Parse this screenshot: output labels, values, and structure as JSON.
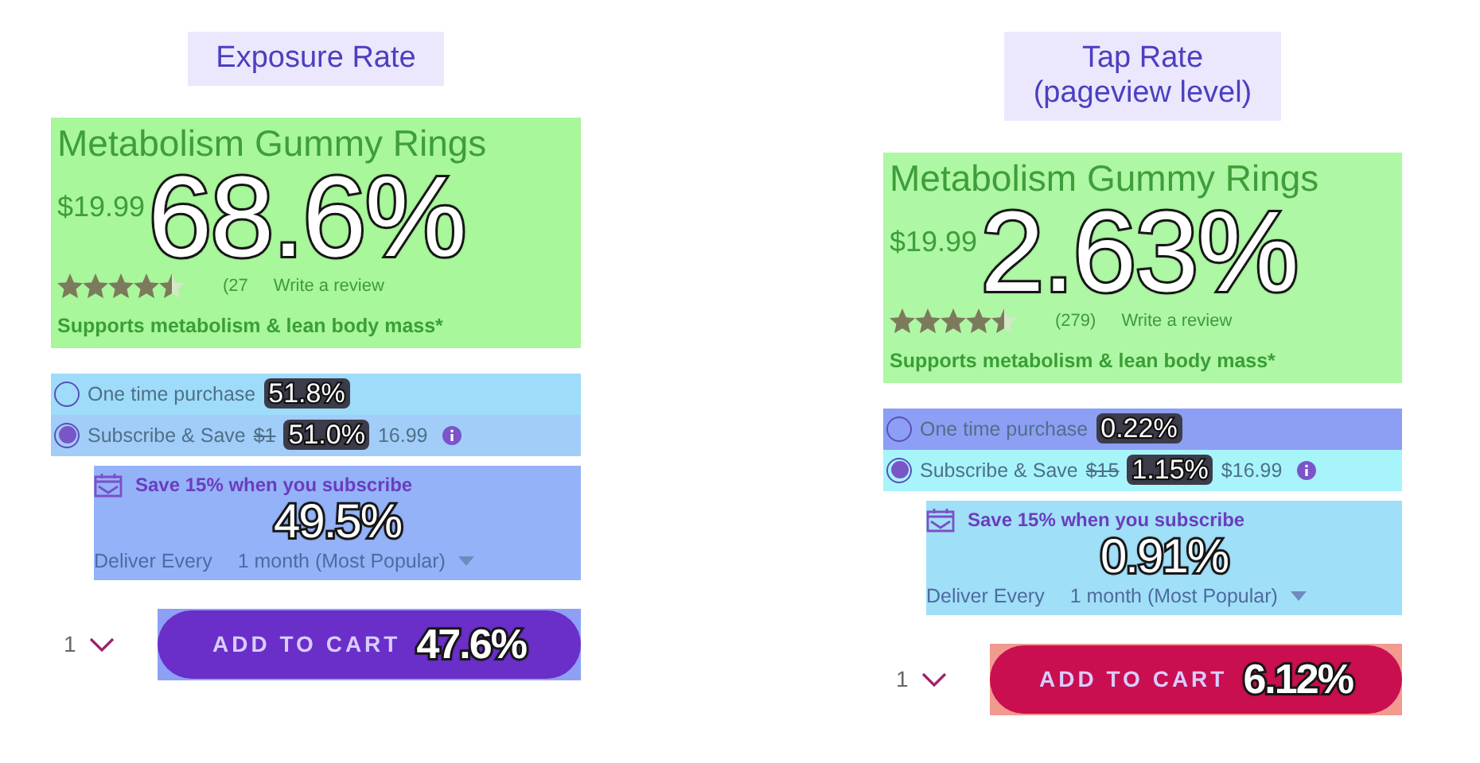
{
  "panels": [
    {
      "title": "Exposure Rate",
      "product": {
        "name": "Metabolism Gummy Rings",
        "price": "$19.99",
        "stars": 4.5,
        "reviews": "(27",
        "review_link": "Write a review",
        "tagline": "Supports metabolism & lean body mass*",
        "color": "#a8f79a",
        "rate": "68.6%"
      },
      "options": [
        {
          "label": "One time purchase",
          "selected": false,
          "color": "#9fdcfa",
          "rate": "51.8%"
        },
        {
          "label": "Subscribe & Save",
          "selected": true,
          "strike_price": "$1",
          "price": "16.99",
          "color": "#a1cdf8",
          "rate": "51.0%"
        }
      ],
      "subscribe_box": {
        "heading": "Save 15% when you subscribe",
        "deliver_label": "Deliver Every",
        "frequency": "1 month (Most Popular)",
        "color": "#94b2f8",
        "rate": "49.5%"
      },
      "quantity": "1",
      "cart": {
        "color": "#8ea0f5",
        "rate": "47.6%",
        "button": {
          "label": "ADD TO CART",
          "color": "#6a2ec9"
        }
      }
    },
    {
      "title": "Tap Rate\n(pageview level)",
      "product": {
        "name": "Metabolism Gummy Rings",
        "price": "$19.99",
        "stars": 4.5,
        "reviews": "(279)",
        "review_link": "Write a review",
        "tagline": "Supports metabolism & lean body mass*",
        "color": "#aef7a4",
        "rate": "2.63%"
      },
      "options": [
        {
          "label": "One time purchase",
          "selected": false,
          "color": "#8c9ff5",
          "rate": "0.22%"
        },
        {
          "label": "Subscribe & Save",
          "selected": true,
          "strike_price": "$15",
          "price": "$16.99",
          "color": "#a8f4fb",
          "rate": "1.15%"
        }
      ],
      "subscribe_box": {
        "heading": "Save 15% when you subscribe",
        "deliver_label": "Deliver Every",
        "frequency": "1 month (Most Popular)",
        "color": "#a0dff8",
        "rate": "0.91%"
      },
      "quantity": "1",
      "cart": {
        "color": "#f29a90",
        "rate": "6.12%",
        "button": {
          "label": "ADD TO CART",
          "color": "#c90f4f"
        }
      }
    }
  ]
}
